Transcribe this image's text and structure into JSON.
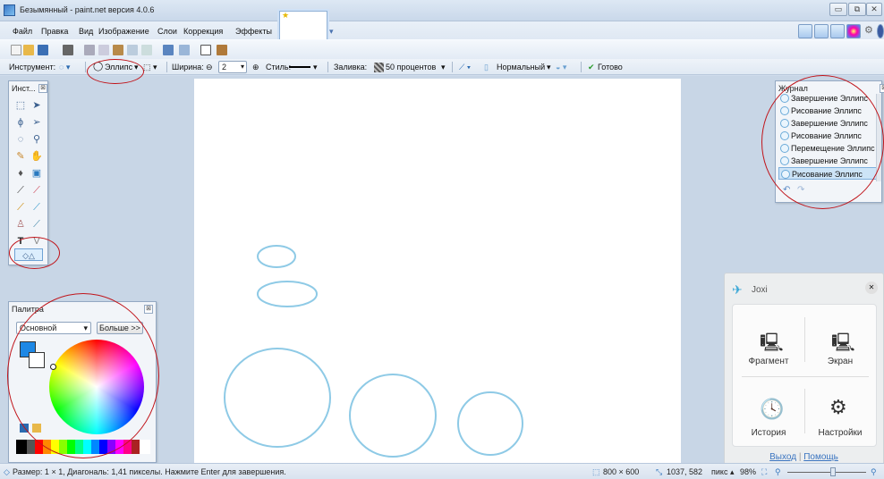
{
  "window": {
    "title": "Безымянный - paint.net версия 4.0.6"
  },
  "menu": {
    "items": [
      "Файл",
      "Правка",
      "Вид",
      "Изображение",
      "Слои",
      "Коррекция",
      "Эффекты"
    ]
  },
  "tool_options": {
    "tool_label": "Инструмент:",
    "shape_label": "Эллипс",
    "width_label": "Ширина:",
    "width_value": "2",
    "style_label": "Стиль:",
    "fill_label": "Заливка:",
    "fill_value": "50 процентов",
    "blend_value": "Нормальный",
    "done_label": "Готово"
  },
  "tools_panel": {
    "title": "Инст..."
  },
  "history_panel": {
    "title": "Журнал",
    "items": [
      "Завершение Эллипс",
      "Рисование Эллипс",
      "Завершение Эллипс",
      "Рисование Эллипс",
      "Перемещение Эллипс",
      "Завершение Эллипс",
      "Рисование Эллипс"
    ],
    "selected_index": 6
  },
  "palette_panel": {
    "title": "Палитра",
    "mode": "Основной",
    "more_button": "Больше >>",
    "primary_color": "#1e88e5",
    "secondary_color": "#ffffff"
  },
  "joxi": {
    "title": "Joxi",
    "actions": [
      "Фрагмент",
      "Экран",
      "История",
      "Настройки"
    ],
    "logout": "Выход",
    "help": "Помощь"
  },
  "status": {
    "hint": "Размер: 1 × 1, Диагональ: 1,41 пикселы. Нажмите Enter для завершения.",
    "image_size": "800 × 600",
    "cursor_pos": "1037, 582",
    "units": "пикс",
    "zoom": "98%"
  },
  "colors": {
    "ellipse_stroke": "#8ecae6",
    "annotation": "#c0141a",
    "accent": "#3a74c0"
  }
}
